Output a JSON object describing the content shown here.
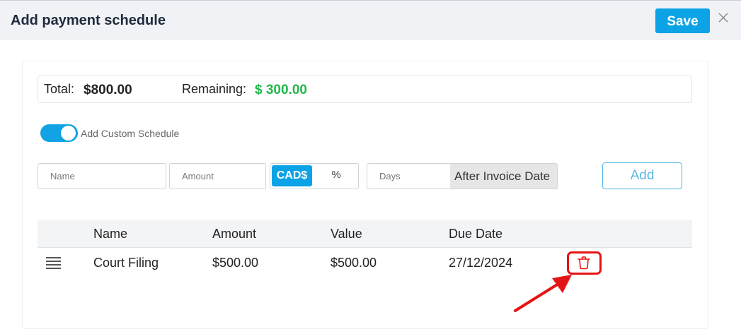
{
  "modal": {
    "title": "Add payment schedule",
    "save_label": "Save",
    "close_icon": "close-icon"
  },
  "summary": {
    "total_label": "Total:",
    "total_value": "$800.00",
    "remaining_label": "Remaining:",
    "remaining_value": "$ 300.00",
    "remaining_color": "#22b84a"
  },
  "custom_schedule": {
    "label": "Add Custom Schedule",
    "enabled": true
  },
  "form": {
    "name_placeholder": "Name",
    "amount_placeholder": "Amount",
    "currency_option": "CAD$",
    "percent_option": "%",
    "days_placeholder": "Days",
    "days_suffix": "After Invoice Date",
    "add_label": "Add"
  },
  "table": {
    "columns": [
      "Name",
      "Amount",
      "Value",
      "Due Date"
    ],
    "rows": [
      {
        "name": "Court Filing",
        "amount": "$500.00",
        "value": "$500.00",
        "due_date": "27/12/2024"
      }
    ]
  },
  "colors": {
    "accent": "#0ba3e6",
    "delete_highlight": "#e51414"
  }
}
